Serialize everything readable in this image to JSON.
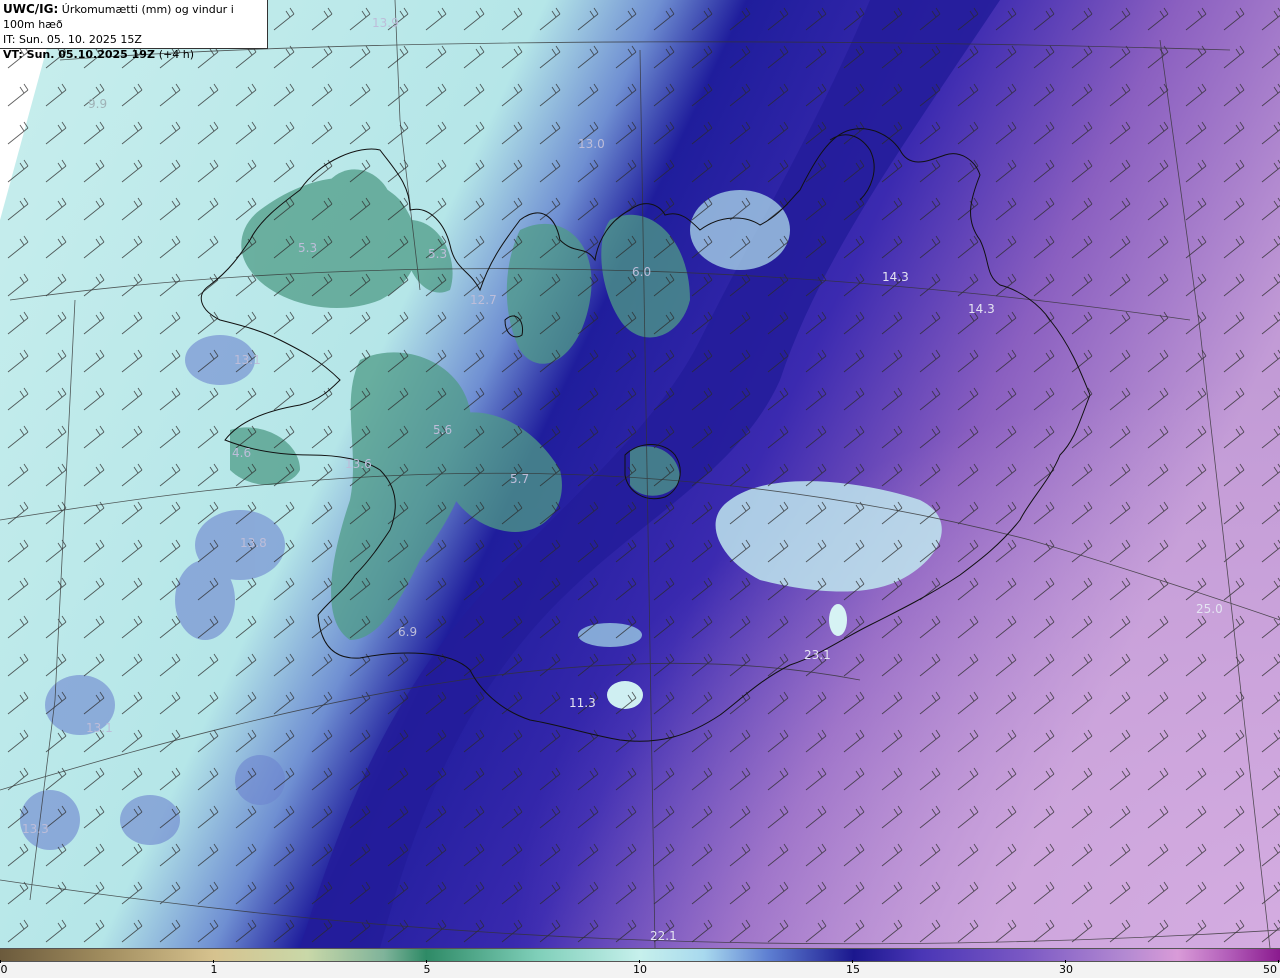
{
  "header": {
    "line1_prefix": "UWC/IG:",
    "line1_text": "Úrkomumætti (mm) og vindur i 100m hæð",
    "line2": "IT: Sun. 05. 10. 2025 15Z",
    "line3_prefix": "VT: Sun. 05.10.2025 19Z",
    "line3_suffix": "(+4 h)"
  },
  "value_labels": [
    "13.9",
    "9.9",
    "13.0",
    "5.3",
    "5.3",
    "6.0",
    "14.3",
    "14.3",
    "12.7",
    "13.1",
    "5.6",
    "4.6",
    "13.6",
    "5.7",
    "13.8",
    "6.9",
    "23.1",
    "11.3",
    "25.0",
    "13.1",
    "13.3",
    "22.1"
  ],
  "colorbar": {
    "ticks": [
      "0",
      "1",
      "5",
      "10",
      "15",
      "30",
      "50"
    ]
  },
  "colors": {
    "ocean_light": "#c8f0ee",
    "land_green": "#4e9a86",
    "deep_blue": "#1a1690",
    "purple": "#8e64c0",
    "pink": "#c39ad8"
  }
}
